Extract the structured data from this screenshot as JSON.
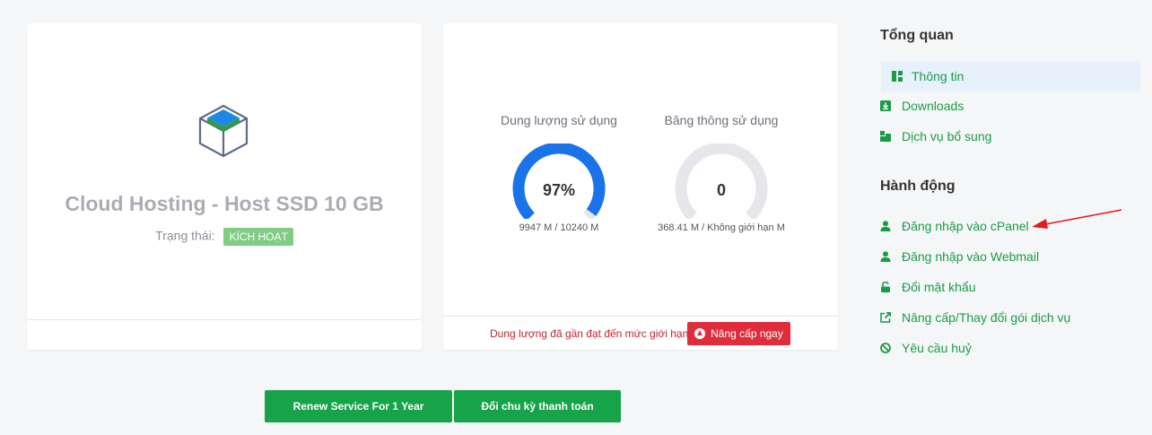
{
  "product": {
    "name": "Cloud Hosting - Host SSD 10 GB",
    "status_label": "Trạng thái:",
    "status_badge": "KÍCH HOẠT"
  },
  "usage": {
    "disk": {
      "title": "Dung lượng sử dụng",
      "percent_label": "97%",
      "percent": 97,
      "detail": "9947 M / 10240 M"
    },
    "bandwidth": {
      "title": "Băng thông sử dụng",
      "percent_label": "0",
      "percent": 0,
      "detail": "368.41 M / Không giới hạn M"
    },
    "warning": "Dung lượng đã gần đạt đến mức giới hạn",
    "upgrade_label": "Nâng cấp ngay"
  },
  "buttons": {
    "renew": "Renew Service For 1 Year",
    "change_cycle": "Đổi chu kỳ thanh toán"
  },
  "sidebar": {
    "overview_heading": "Tổng quan",
    "overview_items": [
      {
        "label": "Thông tin",
        "icon": "dashboard-icon",
        "active": true
      },
      {
        "label": "Downloads",
        "icon": "download-icon",
        "active": false
      },
      {
        "label": "Dịch vụ bổ sung",
        "icon": "addons-icon",
        "active": false
      }
    ],
    "actions_heading": "Hành động",
    "action_items": [
      {
        "label": "Đăng nhập vào cPanel",
        "icon": "user-icon"
      },
      {
        "label": "Đăng nhập vào Webmail",
        "icon": "user-icon"
      },
      {
        "label": "Đổi mật khẩu",
        "icon": "lock-icon"
      },
      {
        "label": "Nâng cấp/Thay đổi gói dịch vụ",
        "icon": "external-link-icon"
      },
      {
        "label": "Yêu cầu huỷ",
        "icon": "ban-icon"
      }
    ]
  },
  "colors": {
    "accent_green": "#1a9c46",
    "button_green": "#17a34a",
    "gauge_blue": "#1a73e8",
    "gauge_track": "#e5e7eb",
    "danger_red": "#e02d3c",
    "badge_green": "#7fcc84"
  }
}
